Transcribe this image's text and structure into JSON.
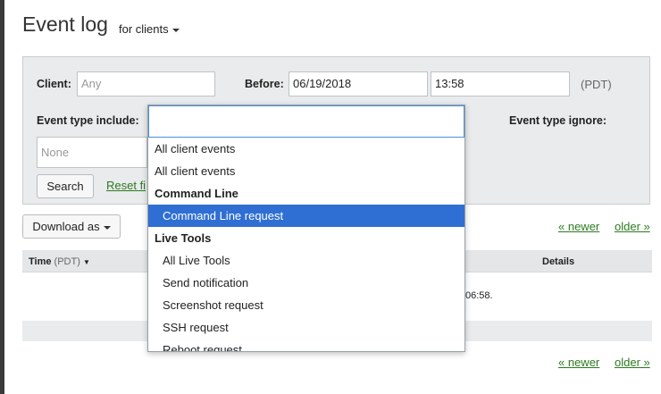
{
  "header": {
    "title": "Event log",
    "filter_label": "for clients"
  },
  "filters": {
    "client_label": "Client:",
    "client_placeholder": "Any",
    "before_label": "Before:",
    "before_date": "06/19/2018",
    "before_time": "13:58",
    "timezone": "(PDT)",
    "event_include_label": "Event type include:",
    "event_ignore_label": "Event type ignore:",
    "none_placeholder": "None",
    "search_button": "Search",
    "reset_link": "Reset fi"
  },
  "toolbar": {
    "download_label": "Download as",
    "newer_link": "« newer",
    "older_link": "older »"
  },
  "table": {
    "time_header": "Time",
    "time_sub": "(PDT)",
    "details_header": "Details",
    "row_fragment": "06:58."
  },
  "dropdown": {
    "items": [
      {
        "label": "All client events",
        "group": false,
        "level": 0,
        "selected": false
      },
      {
        "label": "All client events",
        "group": false,
        "level": 0,
        "selected": false
      },
      {
        "label": "Command Line",
        "group": true,
        "level": 0,
        "selected": false
      },
      {
        "label": "Command Line request",
        "group": false,
        "level": 1,
        "selected": true
      },
      {
        "label": "Live Tools",
        "group": true,
        "level": 0,
        "selected": false
      },
      {
        "label": "All Live Tools",
        "group": false,
        "level": 1,
        "selected": false
      },
      {
        "label": "Send notification",
        "group": false,
        "level": 1,
        "selected": false
      },
      {
        "label": "Screenshot request",
        "group": false,
        "level": 1,
        "selected": false
      },
      {
        "label": "SSH request",
        "group": false,
        "level": 1,
        "selected": false
      },
      {
        "label": "Reboot request",
        "group": false,
        "level": 1,
        "selected": false
      }
    ]
  },
  "colors": {
    "link": "#2d7a1f",
    "selected": "#2f6fd3",
    "panel": "#e9ebec"
  }
}
